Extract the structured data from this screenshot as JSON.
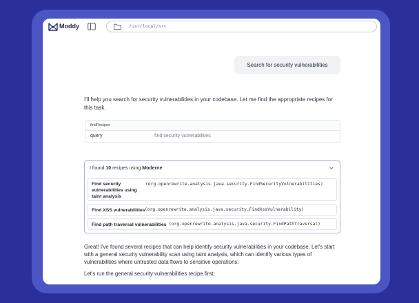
{
  "app": {
    "name": "Moddy",
    "path": "/usr/local/src"
  },
  "icons": {
    "logo": "moddy-logo-icon",
    "sidebar": "sidebar-toggle-icon",
    "folder": "folder-icon",
    "chevron": "chevron-down-icon"
  },
  "colors": {
    "background": "#2b2f9a",
    "frame": "#4b55c4",
    "accent_border": "#aab1ea"
  },
  "chat": {
    "user_message": "Search for security vulnerabilities",
    "assistant_intro": "I'll help you search for security vulnerabilities in your codebase. Let me find the appropriate recipes for this task.",
    "tool_call": {
      "name": "findRecipes",
      "param_key": "query",
      "param_value": "find security vulnerabilities"
    },
    "result": {
      "prefix": "I found ",
      "count": "10",
      "middle": " recipes using ",
      "source": "Moderne",
      "recipes": [
        {
          "name": "Find security vulnerabilities using taint analysis",
          "id": "(org.openrewrite.analysis.java.security.FindSecurityVulnerabilities)"
        },
        {
          "name": "Find XSS vulnerabilities",
          "id": "(org.openrewrite.analysis.java.security.FindXssVulnerability)"
        },
        {
          "name": "Find path traversal vulnerabilities",
          "id": "(org.openrewrite.analysis.java.security.FindPathTraversal)"
        }
      ]
    },
    "reply_1": "Great! I've found several recipes that can help identify security vulnerabilities in your codebase. Let's start with a general security vulnerability scan using taint analysis, which can identify various types of vulnerabilities where untrusted data flows to sensitive operations.",
    "reply_2": "Let's run the general security vulnerabilities recipe first:"
  }
}
